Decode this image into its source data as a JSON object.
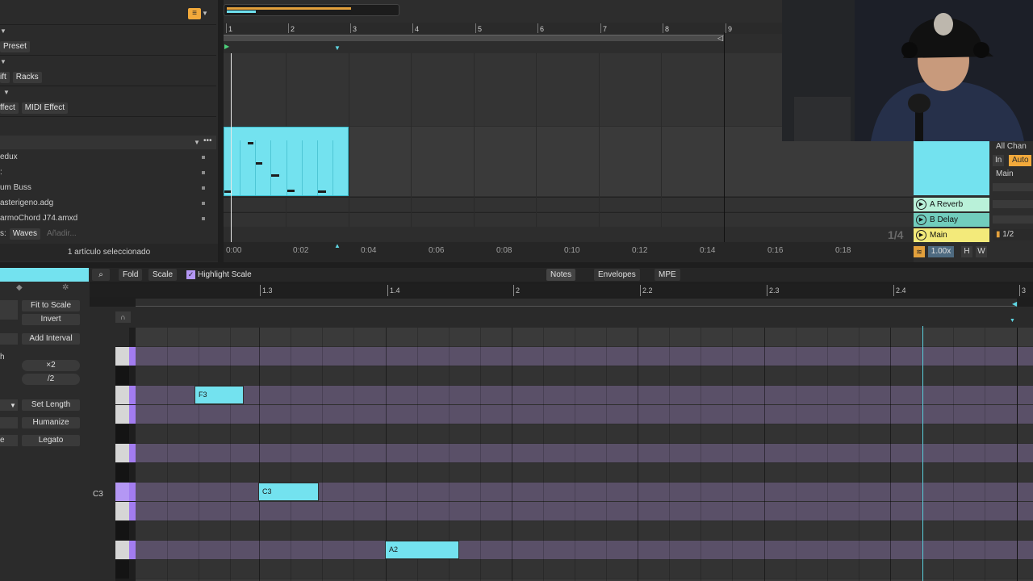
{
  "browser": {
    "rows": [
      {
        "labels": [
          "Preset"
        ]
      },
      {
        "labels": [
          "ift",
          "Racks"
        ]
      },
      {
        "labels": [
          "ffect",
          "MIDI Effect"
        ]
      }
    ],
    "items": [
      {
        "label": "edux"
      },
      {
        "label": ":"
      },
      {
        "label": "um Buss"
      },
      {
        "label": "asterigeno.adg"
      },
      {
        "label": "armoChord J74.amxd"
      }
    ],
    "places_prefix": "s:",
    "places_tag": "Waves",
    "places_add": "Añadir...",
    "status": "1 artículo seleccionado",
    "filter_icon": "filter-icon"
  },
  "arrangement": {
    "bars": [
      "1",
      "2",
      "3",
      "4",
      "5",
      "6",
      "7",
      "8",
      "9"
    ],
    "times": [
      "0:00",
      "0:02",
      "0:04",
      "0:06",
      "0:08",
      "0:10",
      "0:12",
      "0:14",
      "0:16",
      "0:18"
    ],
    "page_indicator": "1/4"
  },
  "mixer": {
    "sends": [
      {
        "label": "A Reverb",
        "color": "#b9f1d9"
      },
      {
        "label": "B Delay",
        "color": "#71cdbd"
      },
      {
        "label": "Main",
        "color": "#f3ea7a"
      }
    ],
    "routing": [
      "All Chan",
      "In",
      "Auto",
      "Main"
    ],
    "ratio": "1/2",
    "tempo_scale": "1.00x",
    "h_button": "H",
    "w_button": "W"
  },
  "clip_panel": {
    "fit_to_scale": "Fit to Scale",
    "invert": "Invert",
    "add_interval": "Add Interval",
    "mul2": "×2",
    "div2": "/2",
    "set_length": "Set Length",
    "humanize": "Humanize",
    "legato": "Legato",
    "side_h": "h",
    "side_e": "e",
    "side_c3": "C3"
  },
  "piano_roll": {
    "toolbar": {
      "fold": "Fold",
      "scale": "Scale",
      "highlight_scale": "Highlight Scale",
      "tabs": [
        "Notes",
        "Envelopes",
        "MPE"
      ]
    },
    "ruler": [
      "1.3",
      "1.4",
      "2",
      "2.2",
      "2.3",
      "2.4",
      "3"
    ],
    "notes": [
      {
        "label": "F3"
      },
      {
        "label": "C3"
      },
      {
        "label": "A2"
      }
    ]
  },
  "colors": {
    "clip": "#73e2ef",
    "scale_lane": "#5a5068",
    "accent_orange": "#f2a93b",
    "key_mark": "#a27cf0"
  }
}
